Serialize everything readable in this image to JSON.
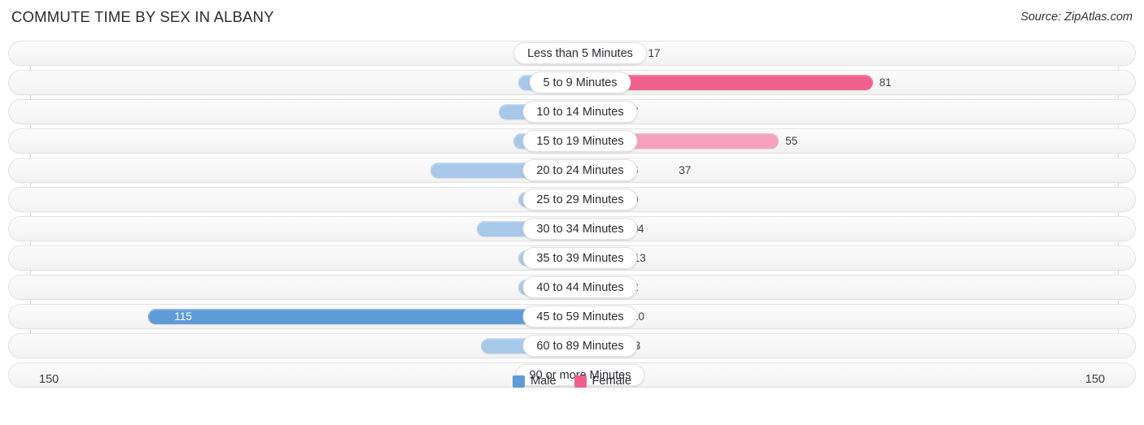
{
  "header": {
    "title": "COMMUTE TIME BY SEX IN ALBANY",
    "source": "Source: ZipAtlas.com"
  },
  "axis": {
    "left_label": "150",
    "right_label": "150",
    "max": 150
  },
  "legend": {
    "items": [
      {
        "label": "Male",
        "color": "#5e9bd8"
      },
      {
        "label": "Female",
        "color": "#f0608c"
      }
    ]
  },
  "colors": {
    "male_light": "#a8c8ea",
    "male_strong": "#5e9bd8",
    "female_light": "#f4a0be",
    "female_strong": "#f0608c"
  },
  "chart_data": {
    "type": "bar",
    "orientation": "horizontal",
    "layout": "diverging-bidirectional",
    "title": "COMMUTE TIME BY SEX IN ALBANY",
    "subtitle": "Source: ZipAtlas.com",
    "xlabel": "",
    "ylabel": "",
    "xlim": [
      150,
      150
    ],
    "axis_max": 150,
    "grid": false,
    "legend_position": "bottom-center",
    "categories": [
      "Less than 5 Minutes",
      "5 to 9 Minutes",
      "10 to 14 Minutes",
      "15 to 19 Minutes",
      "20 to 24 Minutes",
      "25 to 29 Minutes",
      "30 to 34 Minutes",
      "35 to 39 Minutes",
      "40 to 44 Minutes",
      "45 to 59 Minutes",
      "60 to 89 Minutes",
      "90 or more Minutes"
    ],
    "series": [
      {
        "name": "Male",
        "side": "left",
        "color": "#a8c8ea",
        "values": [
          0,
          0,
          18,
          14,
          37,
          6,
          24,
          0,
          4,
          115,
          23,
          11
        ]
      },
      {
        "name": "Female",
        "side": "right",
        "color": "#f4a0be",
        "values": [
          17,
          81,
          7,
          55,
          6,
          0,
          0,
          13,
          2,
          10,
          5,
          0
        ]
      }
    ]
  },
  "rows": [
    {
      "label": "Less than 5 Minutes",
      "male": "0",
      "female": "17"
    },
    {
      "label": "5 to 9 Minutes",
      "male": "0",
      "female": "81"
    },
    {
      "label": "10 to 14 Minutes",
      "male": "18",
      "female": "7"
    },
    {
      "label": "15 to 19 Minutes",
      "male": "14",
      "female": "55"
    },
    {
      "label": "20 to 24 Minutes",
      "male": "37",
      "female": "6"
    },
    {
      "label": "25 to 29 Minutes",
      "male": "6",
      "female": "0"
    },
    {
      "label": "30 to 34 Minutes",
      "male": "24",
      "female": "0"
    },
    {
      "label": "35 to 39 Minutes",
      "male": "0",
      "female": "13"
    },
    {
      "label": "40 to 44 Minutes",
      "male": "4",
      "female": "2"
    },
    {
      "label": "45 to 59 Minutes",
      "male": "115",
      "female": "10"
    },
    {
      "label": "60 to 89 Minutes",
      "male": "23",
      "female": "5"
    },
    {
      "label": "90 or more Minutes",
      "male": "11",
      "female": "0"
    }
  ]
}
